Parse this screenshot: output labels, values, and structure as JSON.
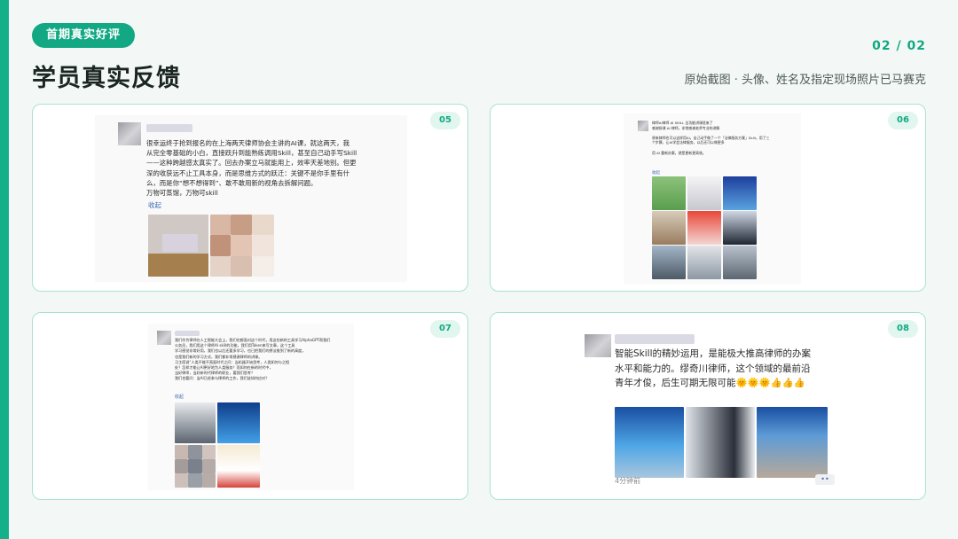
{
  "header": {
    "tag": "首期真实好评",
    "title": "学员真实反馈",
    "page_number": "02 / 02",
    "subtitle": "原始截图 · 头像、姓名及指定现场照片已马赛克"
  },
  "colors": {
    "accent": "#12a883",
    "card_border": "#a8e3d2",
    "badge_bg": "#e1f6ee"
  },
  "cards": [
    {
      "number": "05",
      "text": "很幸运终于抢到报名的在上海两天律师协会主讲的AI课，就这两天，我\n从完全零基础的小白，直接跃升到能熟练调用Skill，甚至自己动手写Skill\n——这种跨越感太真实了。回去办案立马就能用上，效率天差地别。但更\n深的收获远不止工具本身，而是思维方式的跃迁：关键不是你手里有什\n么，而是你“想不想得到”、敢不敢用新的视角去拆解问题。\n万物可蒸馏，万物可skill",
      "collapse": "收起"
    },
    {
      "number": "06",
      "text": "律师AI律师 AI SKILL 全功能讲课班来了\n感谢授课 AI 律师，非常感谢老师专业的讲解\n\n原来律师也可以这样用AI，自己动手做了一个「法律服务方案」Skill，用了三\n个步骤，让AI学会法律服务，以后还可以做更多\n\n用 AI 重新办案，就是更新更高效。",
      "collapse": "收起"
    },
    {
      "number": "07",
      "text": "我们作为律师在人工智能大会上，我们也都面对这个时代，用这些新的工具学习AlphaGPT帮我们\n公务员，我们用这个律师AI skill的功能，我们用Token来写文章，这个工具\n学习感觉非常好用，我们也以后还要多学习，也已把我们的想法推到了新的高度，\n也是我们新的学习方式，我们都非常感谢律师的讲课。\n习主席说“人类不能不直面时代之问：当机器开始思考，人类如何与之相\n处？怎样才能让AI更好地为人类服务？而如何在新的时代中，\n当好律师，当好新时代律师的职业，要我们思考？\n我们也要问：当AI已经参与律师的工作，我们该如何应对？",
      "collapse": "收起"
    },
    {
      "number": "08",
      "text": "智能Skill的精妙运用，是能极大推高律师的办案\n水平和能力的。缪奇川律师，这个领域的最前沿\n青年才俊，后生可期无限可能🌞🌞🌞👍👍👍",
      "time": "4分钟前",
      "dots": "••"
    }
  ]
}
